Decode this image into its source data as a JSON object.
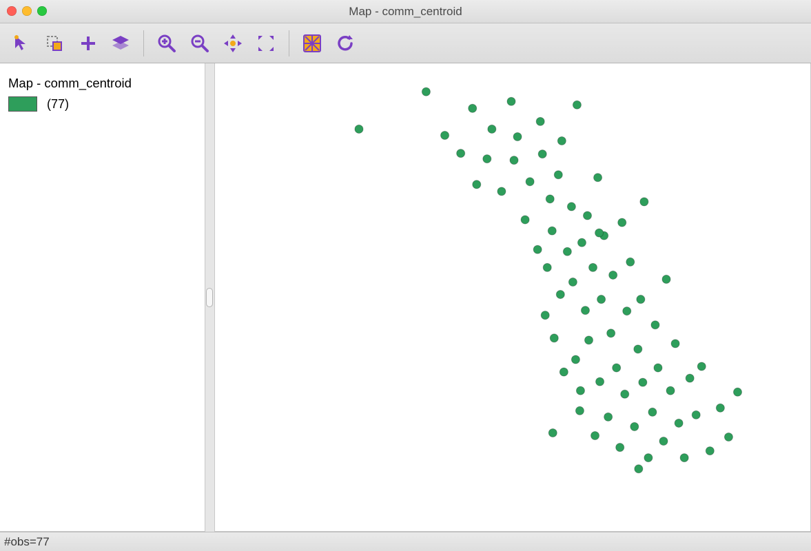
{
  "window": {
    "title": "Map - comm_centroid"
  },
  "toolbar": {
    "tools": [
      {
        "name": "select-tool",
        "type": "pointer"
      },
      {
        "name": "invert-select",
        "type": "invert"
      },
      {
        "name": "add-layer",
        "type": "plus"
      },
      {
        "name": "layers",
        "type": "layers"
      },
      {
        "sep": true
      },
      {
        "name": "zoom-in",
        "type": "zoom-in"
      },
      {
        "name": "zoom-out",
        "type": "zoom-out"
      },
      {
        "name": "pan",
        "type": "pan"
      },
      {
        "name": "full-extent",
        "type": "extent"
      },
      {
        "sep": true
      },
      {
        "name": "basemap",
        "type": "basemap"
      },
      {
        "name": "refresh",
        "type": "refresh"
      }
    ]
  },
  "legend": {
    "title": "Map - comm_centroid",
    "swatch_color": "#2e9e5b",
    "count_label": "(77)"
  },
  "status": {
    "text": "#obs=77"
  },
  "colors": {
    "accent": "#7a3fc4",
    "highlight": "#f2a91a"
  },
  "chart_data": {
    "type": "scatter",
    "title": "Map - comm_centroid",
    "n": 77,
    "point_color": "#2e9e5b",
    "point_radius": 6,
    "xlim": [
      0,
      860
    ],
    "ylim": [
      0,
      660
    ],
    "points": [
      [
        305,
        41
      ],
      [
        332,
        104
      ],
      [
        355,
        130
      ],
      [
        372,
        65
      ],
      [
        378,
        175
      ],
      [
        393,
        138
      ],
      [
        400,
        95
      ],
      [
        414,
        185
      ],
      [
        428,
        55
      ],
      [
        432,
        140
      ],
      [
        437,
        106
      ],
      [
        448,
        226
      ],
      [
        455,
        171
      ],
      [
        466,
        269
      ],
      [
        470,
        84
      ],
      [
        473,
        131
      ],
      [
        477,
        364
      ],
      [
        480,
        295
      ],
      [
        484,
        196
      ],
      [
        487,
        242
      ],
      [
        490,
        397
      ],
      [
        496,
        161
      ],
      [
        499,
        334
      ],
      [
        501,
        112
      ],
      [
        504,
        446
      ],
      [
        509,
        272
      ],
      [
        515,
        207
      ],
      [
        517,
        316
      ],
      [
        521,
        428
      ],
      [
        523,
        60
      ],
      [
        527,
        502
      ],
      [
        528,
        473
      ],
      [
        530,
        259
      ],
      [
        535,
        357
      ],
      [
        538,
        220
      ],
      [
        540,
        400
      ],
      [
        546,
        295
      ],
      [
        549,
        538
      ],
      [
        553,
        165
      ],
      [
        556,
        460
      ],
      [
        558,
        341
      ],
      [
        562,
        249
      ],
      [
        568,
        511
      ],
      [
        572,
        390
      ],
      [
        575,
        306
      ],
      [
        580,
        440
      ],
      [
        585,
        555
      ],
      [
        588,
        230
      ],
      [
        592,
        478
      ],
      [
        595,
        358
      ],
      [
        600,
        287
      ],
      [
        606,
        525
      ],
      [
        611,
        413
      ],
      [
        615,
        341
      ],
      [
        618,
        461
      ],
      [
        620,
        200
      ],
      [
        626,
        570
      ],
      [
        632,
        504
      ],
      [
        636,
        378
      ],
      [
        640,
        440
      ],
      [
        648,
        546
      ],
      [
        652,
        312
      ],
      [
        658,
        473
      ],
      [
        665,
        405
      ],
      [
        670,
        520
      ],
      [
        678,
        570
      ],
      [
        686,
        455
      ],
      [
        695,
        508
      ],
      [
        703,
        438
      ],
      [
        715,
        560
      ],
      [
        730,
        498
      ],
      [
        742,
        540
      ],
      [
        755,
        475
      ],
      [
        488,
        534
      ],
      [
        612,
        586
      ],
      [
        555,
        245
      ],
      [
        208,
        95
      ]
    ]
  }
}
